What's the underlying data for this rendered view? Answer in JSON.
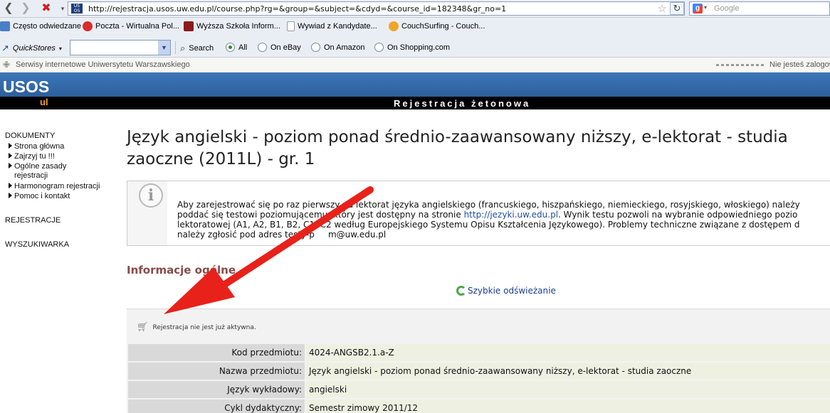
{
  "browser": {
    "url": "http://rejestracja.usos.uw.edu.pl/course.php?rg=&group=&subject=&cdyd=&course_id=182348&gr_no=1",
    "search_placeholder": "Google",
    "bookmarks": [
      {
        "label": "Często odwiedzane",
        "icon": "frequent-icon"
      },
      {
        "label": "Poczta - Wirtualna Pol...",
        "icon": "wp-mail-icon"
      },
      {
        "label": "Wyższa Szkoła Inform...",
        "icon": "wsi-icon"
      },
      {
        "label": "Wywiad z Kandydate...",
        "icon": "page-icon"
      },
      {
        "label": "CouchSurfing - Couch...",
        "icon": "couchsurfing-icon"
      }
    ],
    "toolbar": {
      "quickstores_label": "QuickStores",
      "search_label": "Search",
      "options": [
        "All",
        "On eBay",
        "On Amazon",
        "On Shopping.com"
      ],
      "selected_option": "All"
    },
    "infobar_left": "Serwisy internetowe Uniwersytetu Warszawskiego",
    "infobar_right": "Nie jesteś zalogow"
  },
  "header": {
    "logo": "USOS",
    "logo_sub": "ul",
    "bar_title": "Rejestracja żetonowa",
    "accent_color": "#2c5f9c"
  },
  "sidebar": {
    "section_documents": "DOKUMENTY",
    "items": [
      {
        "label": "Strona główna"
      },
      {
        "label": "Zajrzyj tu !!!"
      },
      {
        "label": "Ogólne zasady",
        "label2": "rejestracji"
      },
      {
        "label": "Harmonogram rejestracji"
      },
      {
        "label": "Pomoc i kontakt"
      }
    ],
    "section_registrations": "REJESTRACJE",
    "section_search": "WYSZUKIWARKA"
  },
  "main": {
    "title_line1": "Język angielski - poziom ponad średnio-zaawansowany niższy, e-lektorat - studia",
    "title_line2": "zaoczne (2011L) - gr. 1",
    "info": {
      "line1": "Aby zarejestrować się po raz pierwszy na lektorat języka angielskiego (francuskiego, hiszpańskiego, niemieckiego, rosyjskiego, włoskiego) należy",
      "line2_a": "poddać się testowi poziomującemu, który jest dostępny na stronie ",
      "line2_link": "http://jezyki.uw.edu.pl",
      "line2_b": ". Wynik testu pozwoli na wybranie odpowiedniego pozio",
      "line3": "lektoratowej (A1, A2, B1, B2, C1, C2 według Europejskiego Systemu Opisu Kształcenia Językowego). Problemy techniczne związane z dostępem d",
      "line4": "należy zgłosić pod adres testy-p     m@uw.edu.pl"
    },
    "section_title": "Informacje ogólne",
    "refresh_label": "Szybkie odświeżanie",
    "registration_status": "Rejestracja nie jest już aktywna.",
    "details": [
      {
        "label": "Kod przedmiotu:",
        "value": "4024-ANGSB2.1.a-Z"
      },
      {
        "label": "Nazwa przedmiotu:",
        "value": "Język angielski - poziom ponad średnio-zaawansowany niższy, e-lektorat - studia zaoczne"
      },
      {
        "label": "Język wykładowy:",
        "value": "angielski"
      },
      {
        "label": "Cykl dydaktyczny:",
        "value": "Semestr zimowy 2011/12"
      }
    ]
  },
  "annotation_color": "#e8211a"
}
